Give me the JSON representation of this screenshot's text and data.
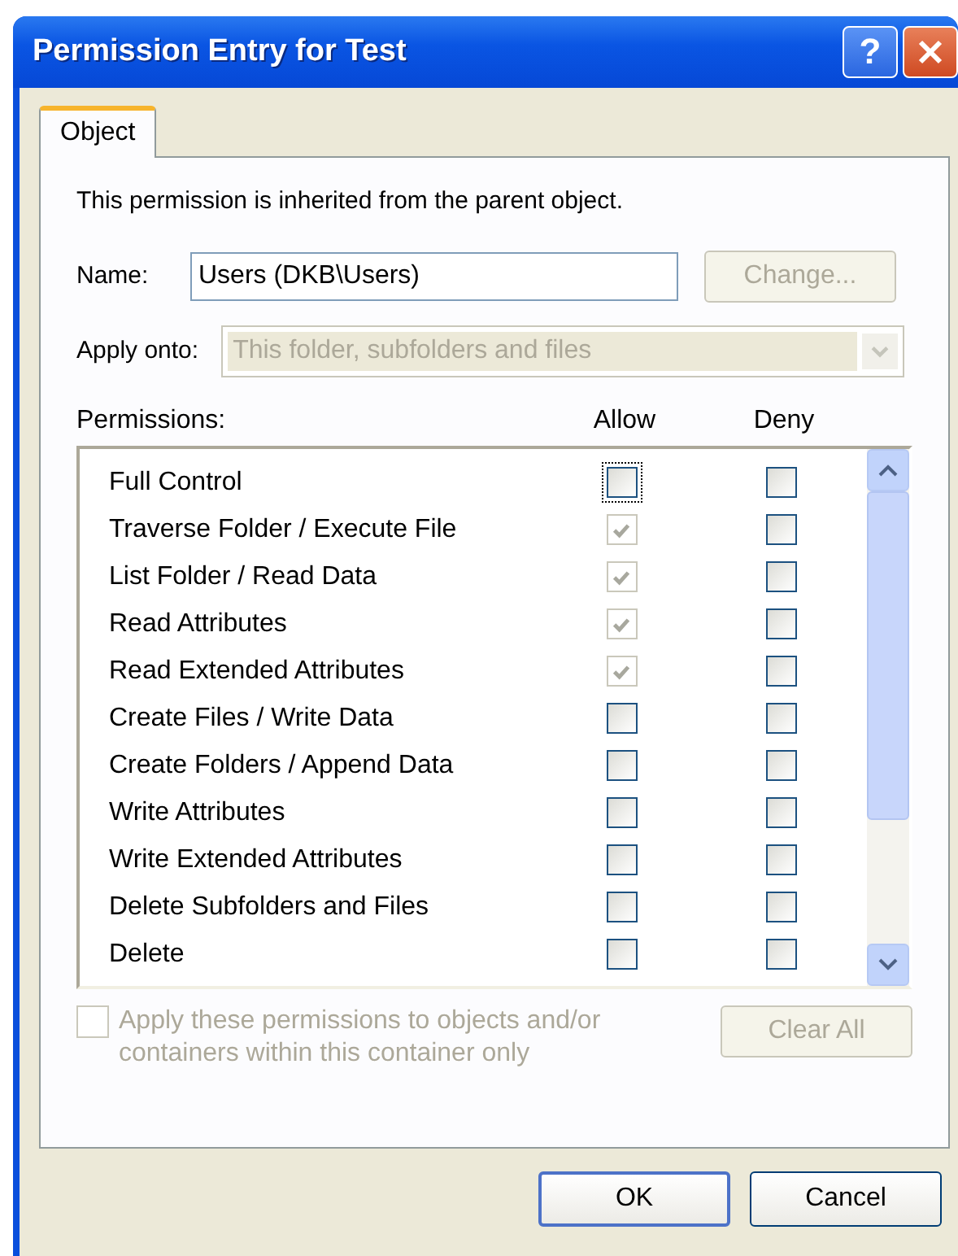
{
  "window": {
    "title": "Permission Entry for Test",
    "help_button": "?"
  },
  "tabs": [
    {
      "label": "Object",
      "selected": true
    }
  ],
  "inherited_note": "This permission is inherited from the parent object.",
  "name": {
    "label": "Name:",
    "value": "Users (DKB\\Users)",
    "button": {
      "label": "Change...",
      "disabled": true
    }
  },
  "apply_onto": {
    "label": "Apply onto:",
    "value": "This folder, subfolders and files",
    "disabled": true
  },
  "permissions": {
    "label": "Permissions:",
    "columns": [
      "Allow",
      "Deny"
    ],
    "rows": [
      {
        "name": "Full Control",
        "allow": {
          "checked": false,
          "disabled": false,
          "focused": true
        },
        "deny": {
          "checked": false,
          "disabled": false
        }
      },
      {
        "name": "Traverse Folder / Execute File",
        "allow": {
          "checked": true,
          "disabled": true,
          "focused": false
        },
        "deny": {
          "checked": false,
          "disabled": false
        }
      },
      {
        "name": "List Folder / Read Data",
        "allow": {
          "checked": true,
          "disabled": true,
          "focused": false
        },
        "deny": {
          "checked": false,
          "disabled": false
        }
      },
      {
        "name": "Read Attributes",
        "allow": {
          "checked": true,
          "disabled": true,
          "focused": false
        },
        "deny": {
          "checked": false,
          "disabled": false
        }
      },
      {
        "name": "Read Extended Attributes",
        "allow": {
          "checked": true,
          "disabled": true,
          "focused": false
        },
        "deny": {
          "checked": false,
          "disabled": false
        }
      },
      {
        "name": "Create Files / Write Data",
        "allow": {
          "checked": false,
          "disabled": false,
          "focused": false
        },
        "deny": {
          "checked": false,
          "disabled": false
        }
      },
      {
        "name": "Create Folders / Append Data",
        "allow": {
          "checked": false,
          "disabled": false,
          "focused": false
        },
        "deny": {
          "checked": false,
          "disabled": false
        }
      },
      {
        "name": "Write Attributes",
        "allow": {
          "checked": false,
          "disabled": false,
          "focused": false
        },
        "deny": {
          "checked": false,
          "disabled": false
        }
      },
      {
        "name": "Write Extended Attributes",
        "allow": {
          "checked": false,
          "disabled": false,
          "focused": false
        },
        "deny": {
          "checked": false,
          "disabled": false
        }
      },
      {
        "name": "Delete Subfolders and Files",
        "allow": {
          "checked": false,
          "disabled": false,
          "focused": false
        },
        "deny": {
          "checked": false,
          "disabled": false
        }
      },
      {
        "name": "Delete",
        "allow": {
          "checked": false,
          "disabled": false,
          "focused": false
        },
        "deny": {
          "checked": false,
          "disabled": false
        }
      }
    ]
  },
  "apply_within": {
    "label": "Apply these permissions to objects and/or containers within this container only",
    "checked": false,
    "disabled": true
  },
  "clear_all": {
    "label": "Clear All",
    "disabled": true
  },
  "buttons": [
    {
      "label": "OK",
      "default": true
    },
    {
      "label": "Cancel",
      "default": false
    }
  ]
}
